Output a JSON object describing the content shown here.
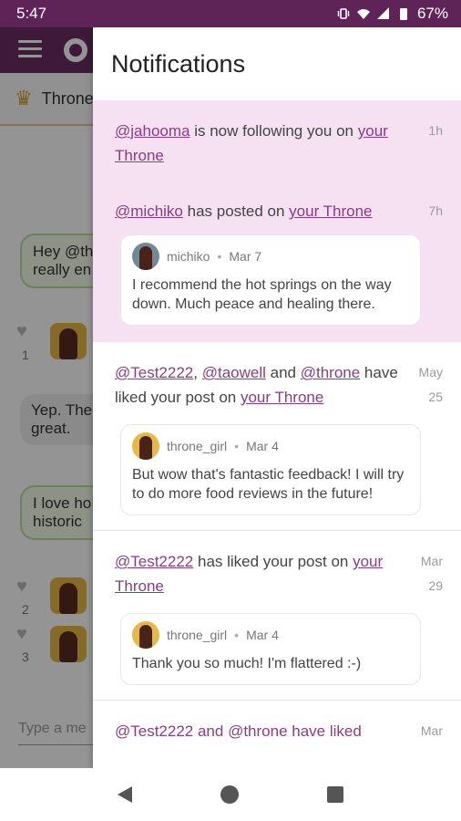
{
  "status_bar": {
    "time": "5:47",
    "battery": "67%",
    "icons": [
      "vibrate-icon",
      "wifi-icon",
      "signal-icon",
      "battery-icon"
    ]
  },
  "background_app": {
    "toolbar_icons": [
      "menu-icon",
      "gear-icon"
    ],
    "header_title": "Throne",
    "messages": [
      {
        "text": "Hey @th\nreally en"
      },
      {
        "text": "Yep. The\ngreat."
      },
      {
        "text": "I love ho\nhistoric"
      }
    ],
    "like_counts": [
      "1",
      "2",
      "3"
    ],
    "input_placeholder": "Type a me"
  },
  "drawer": {
    "title": "Notifications",
    "notifications": [
      {
        "actors": [
          "@jahooma"
        ],
        "middle": " is now following you on ",
        "link": "your Throne",
        "time": "1h"
      },
      {
        "actors": [
          "@michiko"
        ],
        "middle": " has posted on ",
        "link": "your Throne",
        "time": "7h",
        "post": {
          "author": "michiko",
          "date": "Mar 7",
          "body": "I recommend the hot springs on the way down. Much peace and healing there."
        }
      },
      {
        "actor1": "@Test2222",
        "sep1": ", ",
        "actor2": "@taowell",
        "sep2": " and ",
        "actor3": "@throne",
        "middle": " have liked your post on ",
        "link": "your Throne",
        "time": "May 25",
        "post": {
          "author": "throne_girl",
          "date": "Mar 4",
          "body": "But wow that's fantastic feedback! I will try to do more food reviews in the future!"
        }
      },
      {
        "actors": [
          "@Test2222"
        ],
        "middle": " has liked your post on ",
        "link": "your Throne",
        "time": "Mar 29",
        "post": {
          "author": "throne_girl",
          "date": "Mar 4",
          "body": "Thank you so much! I'm flattered :-)"
        }
      },
      {
        "partial": "@Test2222 and @throne have liked",
        "time": "Mar"
      }
    ]
  },
  "nav": {
    "back": "back-icon",
    "home": "home-icon",
    "recents": "recents-icon"
  }
}
